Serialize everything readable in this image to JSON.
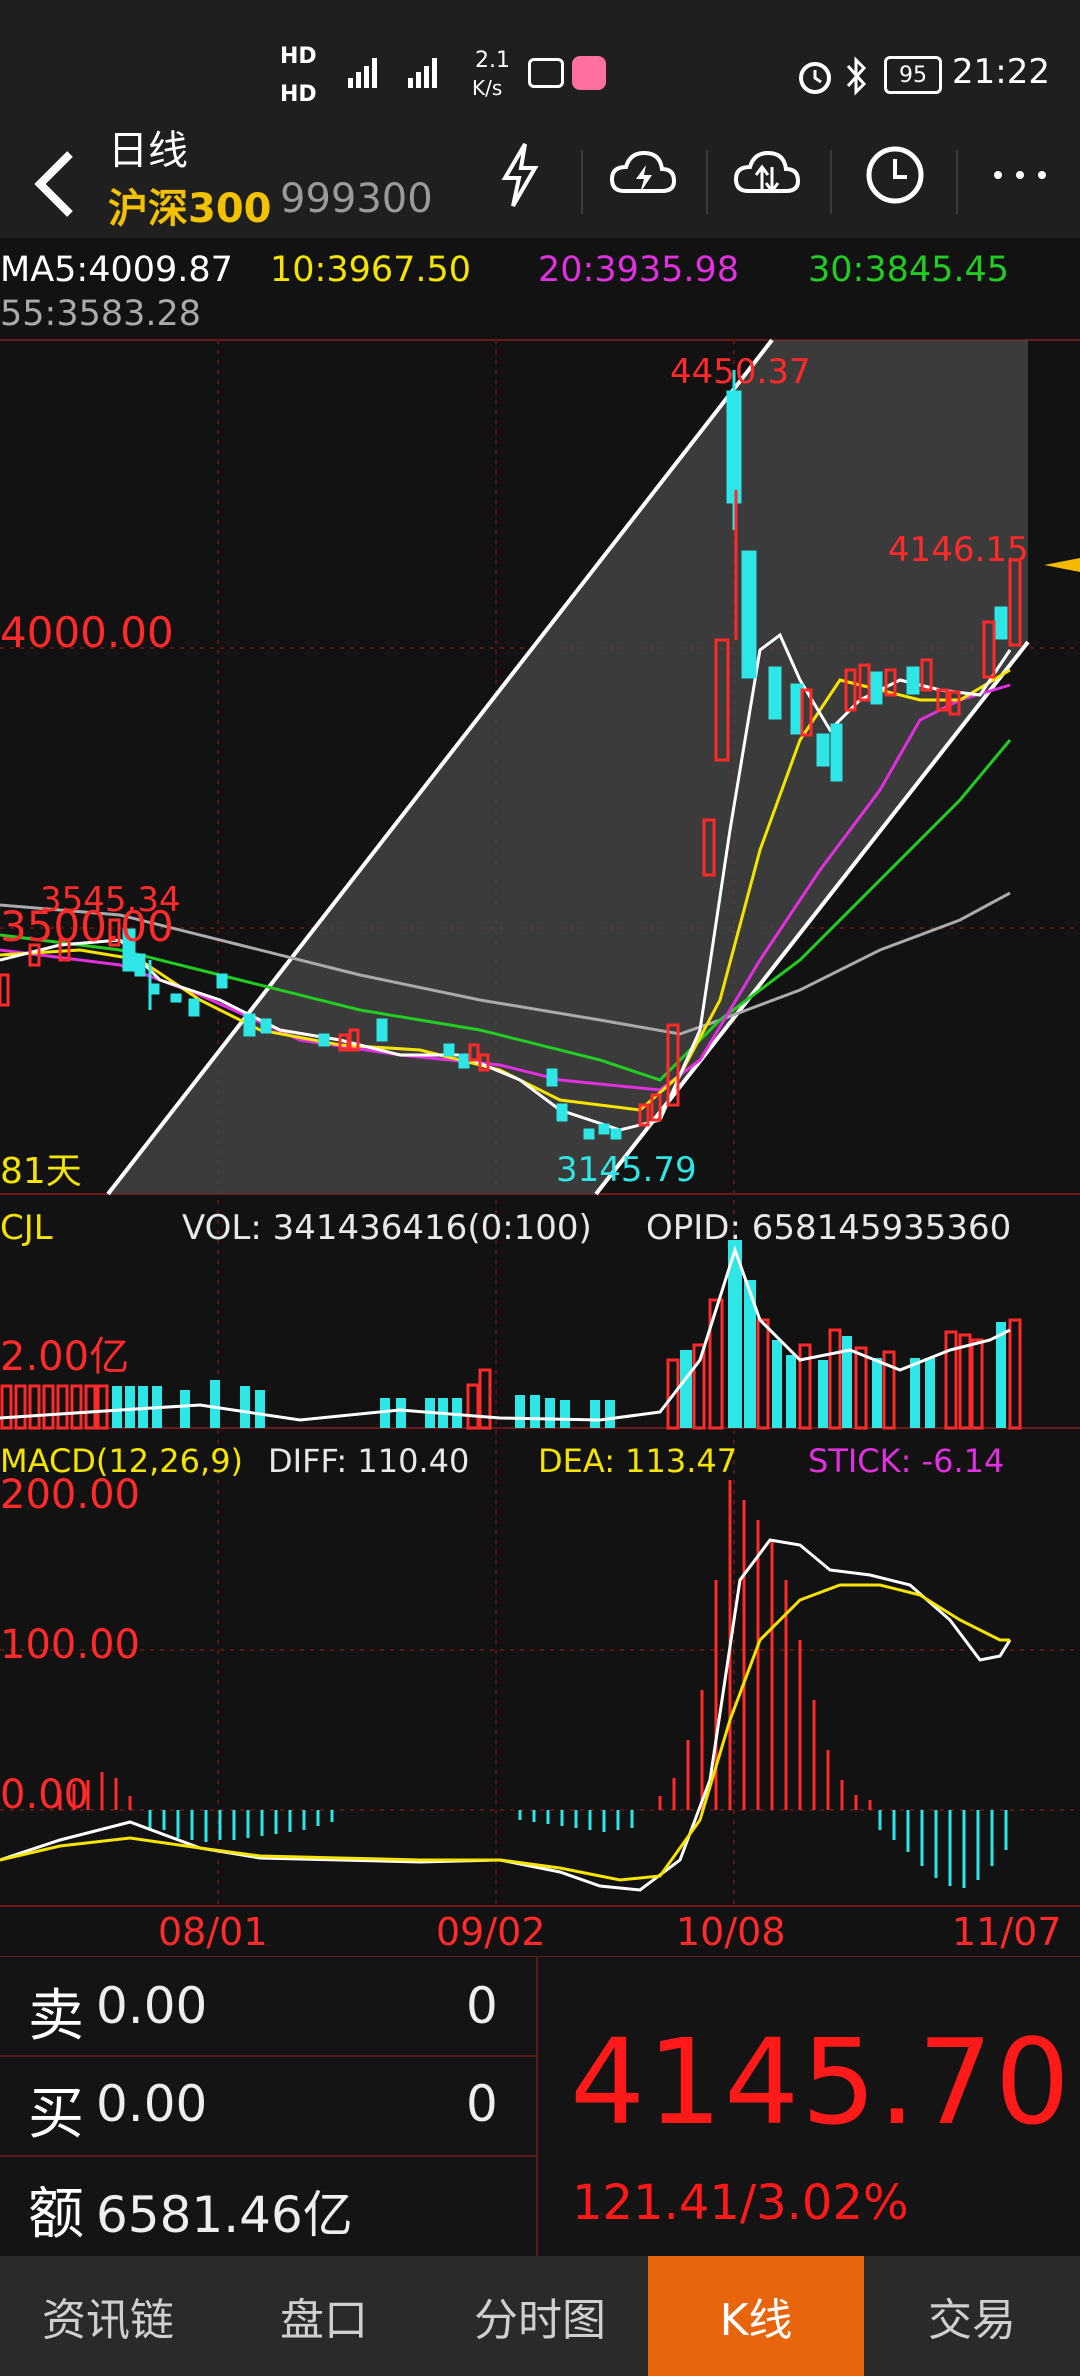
{
  "status": {
    "signal1": "HD",
    "signal2": "HD",
    "net_speed_top": "2.1",
    "net_speed_unit": "K/s",
    "battery": "95",
    "time": "21:22"
  },
  "header": {
    "title": "日线",
    "index_name": "沪深300",
    "index_code": "999300"
  },
  "ma": {
    "ma5": "MA5:4009.87",
    "ma10": "10:3967.50",
    "ma20": "20:3935.98",
    "ma30": "30:3845.45",
    "ma55": "55:3583.28"
  },
  "price_chart": {
    "high_label": "4450.37",
    "recent_label": "4146.15",
    "level_4000": "4000.00",
    "level_3500": "3500.00",
    "left_high_label": "3545.34",
    "low_label": "3145.79",
    "days_label": "81天"
  },
  "volume": {
    "title": "CJL",
    "vol": "VOL: 341436416(0:100)",
    "opid": "OPID: 658145935360",
    "level": "2.00亿"
  },
  "macd": {
    "title": "MACD(12,26,9)",
    "diff": "DIFF: 110.40",
    "dea": "DEA: 113.47",
    "stick": "STICK: -6.14",
    "level_200": "200.00",
    "level_100": "100.00",
    "level_0": "0.00"
  },
  "dates": [
    "08/01",
    "09/02",
    "10/08",
    "11/07"
  ],
  "quote": {
    "sell_label": "卖",
    "sell_price": "0.00",
    "sell_qty": "0",
    "buy_label": "买",
    "buy_price": "0.00",
    "buy_qty": "0",
    "amount_label": "额",
    "amount_value": "6581.46亿",
    "last_price": "4145.70",
    "change": "121.41/3.02%"
  },
  "tabs": [
    "资讯链",
    "盘口",
    "分时图",
    "K线",
    "交易"
  ],
  "colors": {
    "up": "#ff2a2a",
    "down": "#2ee6e6",
    "ma5": "#ffffff",
    "ma10": "#f5e400",
    "ma20": "#e030e0",
    "ma30": "#22cc22",
    "ma55": "#aaaaaa",
    "accent": "#e8650e"
  }
}
